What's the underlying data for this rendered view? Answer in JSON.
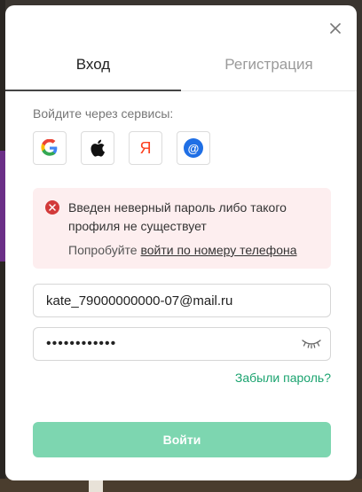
{
  "modal": {
    "tabs": [
      {
        "label": "Вход"
      },
      {
        "label": "Регистрация"
      }
    ],
    "services_label": "Войдите через сервисы:",
    "services": [
      {
        "icon": "google-icon"
      },
      {
        "icon": "apple-icon"
      },
      {
        "icon": "yandex-icon",
        "glyph": "Я"
      },
      {
        "icon": "mailru-icon",
        "glyph": "@"
      }
    ],
    "error": {
      "message": "Введен неверный пароль либо такого профиля не существует",
      "hint_prefix": "Попробуйте ",
      "hint_link": "войти по номеру телефона"
    },
    "email": {
      "value": "kate_79000000000-07@mail.ru"
    },
    "password": {
      "value": "••••••••••••"
    },
    "forgot_label": "Забыли пароль?",
    "submit_label": "Войти"
  },
  "colors": {
    "accent": "#1aa36f",
    "submit_disabled": "#7dd6b0",
    "error_bg": "#fdeeef",
    "error_icon": "#d23a3a"
  }
}
